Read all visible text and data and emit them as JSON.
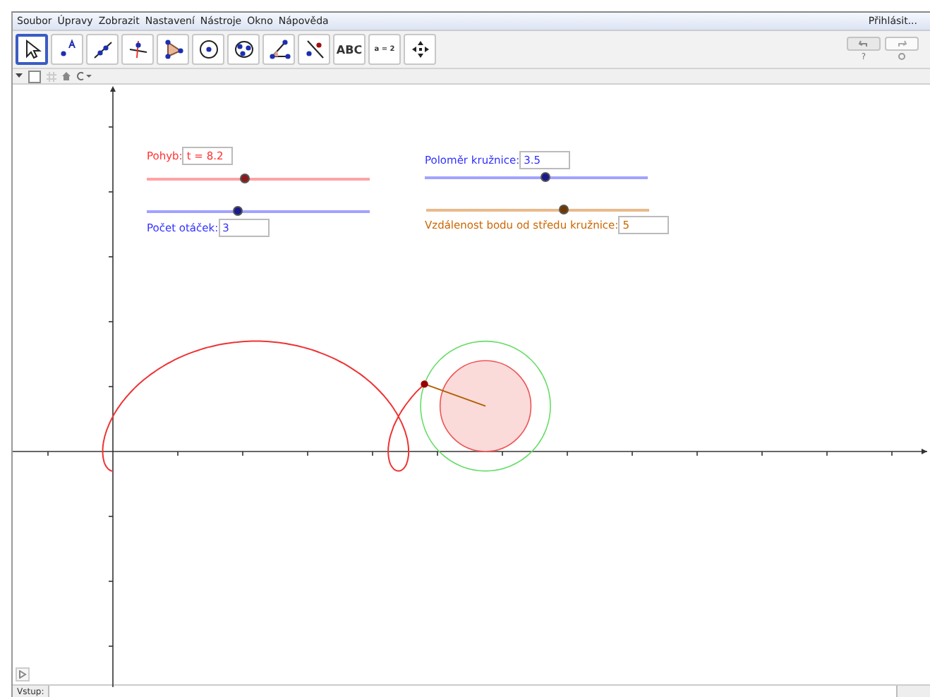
{
  "menu": {
    "items": [
      "Soubor",
      "Úpravy",
      "Zobrazit",
      "Nastavení",
      "Nástroje",
      "Okno",
      "Nápověda"
    ],
    "sign_in": "Přihlásit..."
  },
  "toolbar": {
    "tools": [
      {
        "kind": "move",
        "selected": true
      },
      {
        "kind": "point",
        "selected": false
      },
      {
        "kind": "line",
        "selected": false
      },
      {
        "kind": "perpendicular",
        "selected": false
      },
      {
        "kind": "polygon",
        "selected": false
      },
      {
        "kind": "circle",
        "selected": false
      },
      {
        "kind": "conic",
        "selected": false
      },
      {
        "kind": "angle",
        "selected": false
      },
      {
        "kind": "reflect",
        "selected": false
      },
      {
        "kind": "text",
        "label": "ABC",
        "selected": false
      },
      {
        "kind": "slider",
        "label": "a = 2",
        "selected": false
      },
      {
        "kind": "pan",
        "selected": false
      }
    ],
    "help": "?"
  },
  "sliders": [
    {
      "label": "Pohyb:",
      "value": "t = 8.2",
      "level": 0.44,
      "color": "#ff3030"
    },
    {
      "label": "Počet otáček:",
      "value": "3",
      "level": 0.41,
      "color": "#3030ff"
    },
    {
      "label": "Poloměr kružnice:",
      "value": "3.5",
      "level": 0.54,
      "color": "#3030ff"
    },
    {
      "label": "Vzdálenost bodu od středu kružnice:",
      "value": "5",
      "level": 0.62,
      "color": "#cc6600"
    }
  ],
  "input_bar": {
    "label": "Vstup:"
  }
}
